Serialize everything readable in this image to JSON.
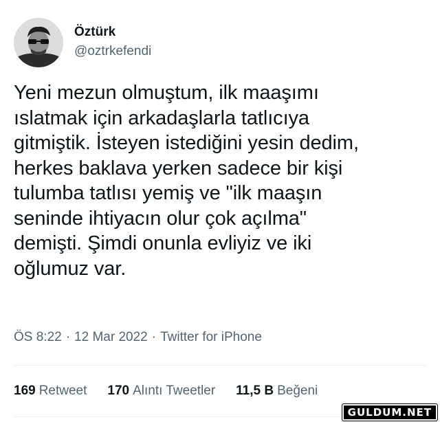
{
  "author": {
    "display_name": "Öztürk",
    "handle": "@oztrkefendi",
    "avatar_icon": "profile-photo-with-sunglasses-icon"
  },
  "tweet": {
    "text": "Yeni mezun olmuştum, ilk maaşımı\nıslatmak için arkadaşlarla tatlıcıya\ngitmiştik. İsteyen istediğini yesin dedim,\nherkes baklava yerken sadece bir kişi\ntulumba tatlısı yemiş ve \"ilk maaşın\nseninde ihtiyacın olur çok açılma\"\ndemişti. Şimdi onunla evliyiz ve iki\noğlumuz var.",
    "time": "ÖS 8:22",
    "separator": "·",
    "date": "12 Mar 2022",
    "source": "Twitter for iPhone"
  },
  "stats": {
    "retweets": {
      "count": "169",
      "label": "Retweet"
    },
    "quotes": {
      "count": "170",
      "label": "Alıntı Tweetler"
    },
    "likes": {
      "count": "11,5 B",
      "label": "Beğeni"
    }
  },
  "watermark": "GULDUM.NET",
  "colors": {
    "text_primary": "#0f1419",
    "text_secondary": "#536471",
    "divider": "#eff3f4",
    "background": "#ffffff"
  }
}
